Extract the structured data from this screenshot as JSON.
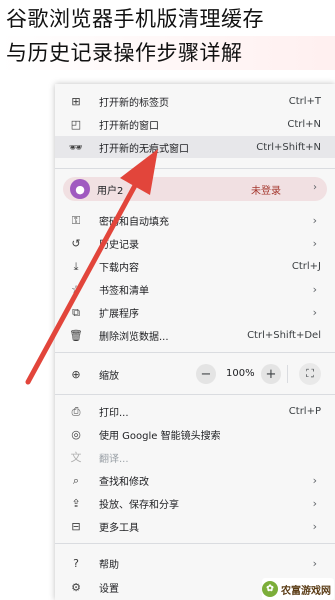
{
  "header": {
    "line1": "谷歌浏览器手机版清理缓存",
    "line2": "与历史记录操作步骤详解"
  },
  "menu": {
    "new_tab": {
      "label": "打开新的标签页",
      "shortcut": "Ctrl+T"
    },
    "new_window": {
      "label": "打开新的窗口",
      "shortcut": "Ctrl+N"
    },
    "new_incognito": {
      "label": "打开新的无痕式窗口",
      "shortcut": "Ctrl+Shift+N"
    },
    "profile": {
      "label": "用户2",
      "status": "未登录"
    },
    "passwords": {
      "label": "密码和自动填充"
    },
    "history": {
      "label": "历史记录"
    },
    "downloads": {
      "label": "下载内容",
      "shortcut": "Ctrl+J"
    },
    "bookmarks": {
      "label": "书签和清单"
    },
    "extensions": {
      "label": "扩展程序"
    },
    "clear_data": {
      "label": "删除浏览数据...",
      "shortcut": "Ctrl+Shift+Del"
    },
    "zoom": {
      "label": "缩放",
      "minus": "−",
      "value": "100%",
      "plus": "+"
    },
    "print": {
      "label": "打印...",
      "shortcut": "Ctrl+P"
    },
    "google_lens": {
      "label": "使用 Google 智能镜头搜索"
    },
    "translate": {
      "label": "翻译..."
    },
    "find_edit": {
      "label": "查找和修改"
    },
    "cast_save_share": {
      "label": "投放、保存和分享"
    },
    "more_tools": {
      "label": "更多工具"
    },
    "help": {
      "label": "帮助"
    },
    "settings": {
      "label": "设置"
    }
  },
  "watermark": {
    "text": "农富游戏网"
  },
  "colors": {
    "arrow": "#e2453b",
    "menu_bg": "#f7f7f7",
    "highlight": "#e7e7ea",
    "profile_bg": "#f1e0e2",
    "status": "#a5382f"
  },
  "icons": [
    "new-tab-icon",
    "new-window-icon",
    "incognito-icon",
    "avatar-icon",
    "key-icon",
    "history-icon",
    "download-icon",
    "bookmark-icon",
    "puzzle-icon",
    "trash-icon",
    "zoom-icon",
    "print-icon",
    "lens-icon",
    "translate-icon",
    "find-icon",
    "share-icon",
    "toolbox-icon",
    "help-icon",
    "gear-icon",
    "fullscreen-icon"
  ]
}
